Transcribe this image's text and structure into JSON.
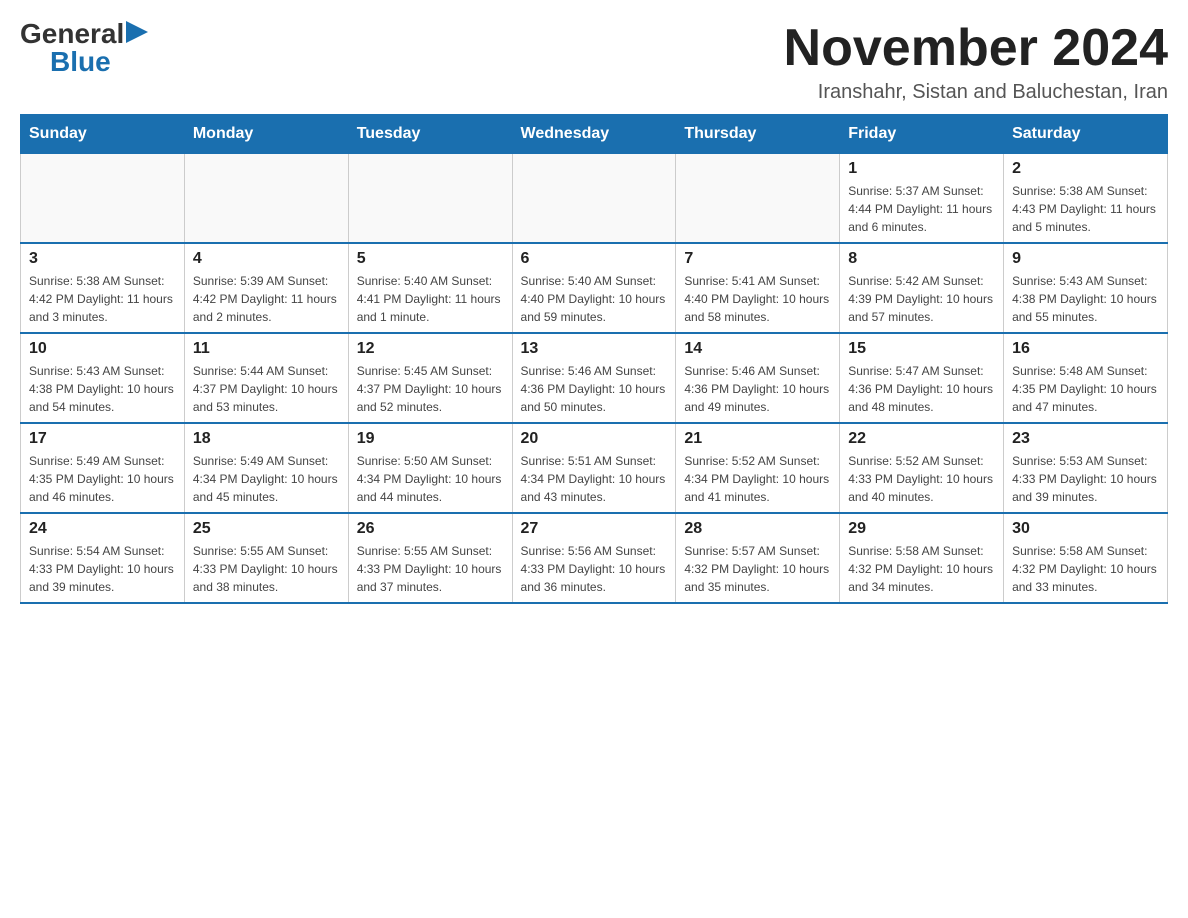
{
  "logo": {
    "general": "General",
    "blue": "Blue",
    "arrow": "▶"
  },
  "title": "November 2024",
  "subtitle": "Iranshahr, Sistan and Baluchestan, Iran",
  "headers": [
    "Sunday",
    "Monday",
    "Tuesday",
    "Wednesday",
    "Thursday",
    "Friday",
    "Saturday"
  ],
  "weeks": [
    [
      {
        "day": "",
        "info": ""
      },
      {
        "day": "",
        "info": ""
      },
      {
        "day": "",
        "info": ""
      },
      {
        "day": "",
        "info": ""
      },
      {
        "day": "",
        "info": ""
      },
      {
        "day": "1",
        "info": "Sunrise: 5:37 AM\nSunset: 4:44 PM\nDaylight: 11 hours and 6 minutes."
      },
      {
        "day": "2",
        "info": "Sunrise: 5:38 AM\nSunset: 4:43 PM\nDaylight: 11 hours and 5 minutes."
      }
    ],
    [
      {
        "day": "3",
        "info": "Sunrise: 5:38 AM\nSunset: 4:42 PM\nDaylight: 11 hours and 3 minutes."
      },
      {
        "day": "4",
        "info": "Sunrise: 5:39 AM\nSunset: 4:42 PM\nDaylight: 11 hours and 2 minutes."
      },
      {
        "day": "5",
        "info": "Sunrise: 5:40 AM\nSunset: 4:41 PM\nDaylight: 11 hours and 1 minute."
      },
      {
        "day": "6",
        "info": "Sunrise: 5:40 AM\nSunset: 4:40 PM\nDaylight: 10 hours and 59 minutes."
      },
      {
        "day": "7",
        "info": "Sunrise: 5:41 AM\nSunset: 4:40 PM\nDaylight: 10 hours and 58 minutes."
      },
      {
        "day": "8",
        "info": "Sunrise: 5:42 AM\nSunset: 4:39 PM\nDaylight: 10 hours and 57 minutes."
      },
      {
        "day": "9",
        "info": "Sunrise: 5:43 AM\nSunset: 4:38 PM\nDaylight: 10 hours and 55 minutes."
      }
    ],
    [
      {
        "day": "10",
        "info": "Sunrise: 5:43 AM\nSunset: 4:38 PM\nDaylight: 10 hours and 54 minutes."
      },
      {
        "day": "11",
        "info": "Sunrise: 5:44 AM\nSunset: 4:37 PM\nDaylight: 10 hours and 53 minutes."
      },
      {
        "day": "12",
        "info": "Sunrise: 5:45 AM\nSunset: 4:37 PM\nDaylight: 10 hours and 52 minutes."
      },
      {
        "day": "13",
        "info": "Sunrise: 5:46 AM\nSunset: 4:36 PM\nDaylight: 10 hours and 50 minutes."
      },
      {
        "day": "14",
        "info": "Sunrise: 5:46 AM\nSunset: 4:36 PM\nDaylight: 10 hours and 49 minutes."
      },
      {
        "day": "15",
        "info": "Sunrise: 5:47 AM\nSunset: 4:36 PM\nDaylight: 10 hours and 48 minutes."
      },
      {
        "day": "16",
        "info": "Sunrise: 5:48 AM\nSunset: 4:35 PM\nDaylight: 10 hours and 47 minutes."
      }
    ],
    [
      {
        "day": "17",
        "info": "Sunrise: 5:49 AM\nSunset: 4:35 PM\nDaylight: 10 hours and 46 minutes."
      },
      {
        "day": "18",
        "info": "Sunrise: 5:49 AM\nSunset: 4:34 PM\nDaylight: 10 hours and 45 minutes."
      },
      {
        "day": "19",
        "info": "Sunrise: 5:50 AM\nSunset: 4:34 PM\nDaylight: 10 hours and 44 minutes."
      },
      {
        "day": "20",
        "info": "Sunrise: 5:51 AM\nSunset: 4:34 PM\nDaylight: 10 hours and 43 minutes."
      },
      {
        "day": "21",
        "info": "Sunrise: 5:52 AM\nSunset: 4:34 PM\nDaylight: 10 hours and 41 minutes."
      },
      {
        "day": "22",
        "info": "Sunrise: 5:52 AM\nSunset: 4:33 PM\nDaylight: 10 hours and 40 minutes."
      },
      {
        "day": "23",
        "info": "Sunrise: 5:53 AM\nSunset: 4:33 PM\nDaylight: 10 hours and 39 minutes."
      }
    ],
    [
      {
        "day": "24",
        "info": "Sunrise: 5:54 AM\nSunset: 4:33 PM\nDaylight: 10 hours and 39 minutes."
      },
      {
        "day": "25",
        "info": "Sunrise: 5:55 AM\nSunset: 4:33 PM\nDaylight: 10 hours and 38 minutes."
      },
      {
        "day": "26",
        "info": "Sunrise: 5:55 AM\nSunset: 4:33 PM\nDaylight: 10 hours and 37 minutes."
      },
      {
        "day": "27",
        "info": "Sunrise: 5:56 AM\nSunset: 4:33 PM\nDaylight: 10 hours and 36 minutes."
      },
      {
        "day": "28",
        "info": "Sunrise: 5:57 AM\nSunset: 4:32 PM\nDaylight: 10 hours and 35 minutes."
      },
      {
        "day": "29",
        "info": "Sunrise: 5:58 AM\nSunset: 4:32 PM\nDaylight: 10 hours and 34 minutes."
      },
      {
        "day": "30",
        "info": "Sunrise: 5:58 AM\nSunset: 4:32 PM\nDaylight: 10 hours and 33 minutes."
      }
    ]
  ]
}
